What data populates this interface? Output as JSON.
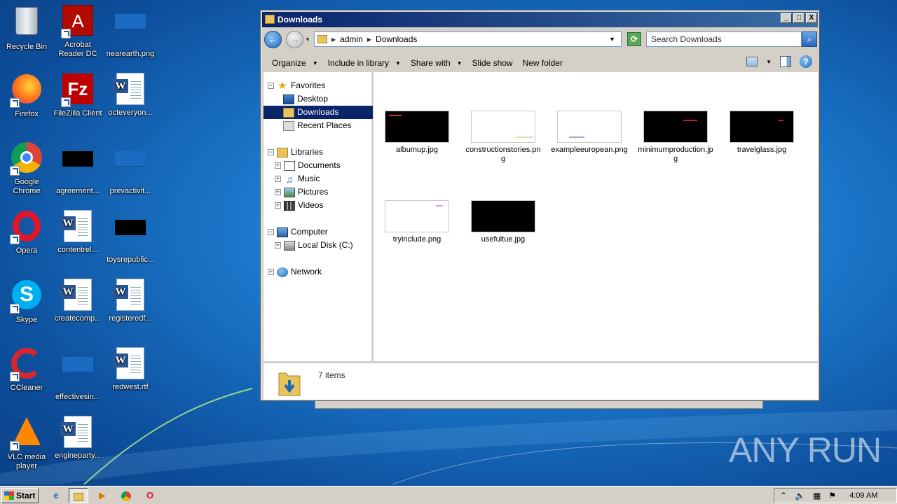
{
  "desktop": {
    "icons": [
      {
        "label": "Recycle Bin"
      },
      {
        "label": "Acrobat Reader DC"
      },
      {
        "label": "nearearth.png"
      },
      {
        "label": "Firefox"
      },
      {
        "label": "FileZilla Client"
      },
      {
        "label": "octeveryon..."
      },
      {
        "label": "Google Chrome"
      },
      {
        "label": "agreement..."
      },
      {
        "label": "prevactivit..."
      },
      {
        "label": "Opera"
      },
      {
        "label": "contentrel..."
      },
      {
        "label": "toysrepublic..."
      },
      {
        "label": "Skype"
      },
      {
        "label": "createcomp..."
      },
      {
        "label": "registeredf..."
      },
      {
        "label": "CCleaner"
      },
      {
        "label": "effectivesin..."
      },
      {
        "label": "redwest.rtf"
      },
      {
        "label": "VLC media player"
      },
      {
        "label": "engineparty..."
      }
    ]
  },
  "window": {
    "title": "Downloads",
    "controls": {
      "minimize": "_",
      "maximize": "□",
      "close": "X"
    },
    "address": {
      "crumb1": "admin",
      "crumb2": "Downloads"
    },
    "search_placeholder": "Search Downloads",
    "toolbar": {
      "organize": "Organize",
      "include": "Include in library",
      "share": "Share with",
      "slideshow": "Slide show",
      "newfolder": "New folder"
    },
    "nav": {
      "favorites": "Favorites",
      "desktop": "Desktop",
      "downloads": "Downloads",
      "recent": "Recent Places",
      "libraries": "Libraries",
      "documents": "Documents",
      "music": "Music",
      "pictures": "Pictures",
      "videos": "Videos",
      "computer": "Computer",
      "localdisk": "Local Disk (C:)",
      "network": "Network"
    },
    "files": [
      {
        "name": "albumup.jpg"
      },
      {
        "name": "constructionstories.png"
      },
      {
        "name": "exampleeuropean.png"
      },
      {
        "name": "minimumproduction.jpg"
      },
      {
        "name": "travelglass.jpg"
      },
      {
        "name": "tryinclude.png"
      },
      {
        "name": "usefultue.jpg"
      }
    ],
    "status": "7 items"
  },
  "taskbar": {
    "start": "Start",
    "clock": "4:09 AM"
  },
  "watermark": "ANY RUN"
}
